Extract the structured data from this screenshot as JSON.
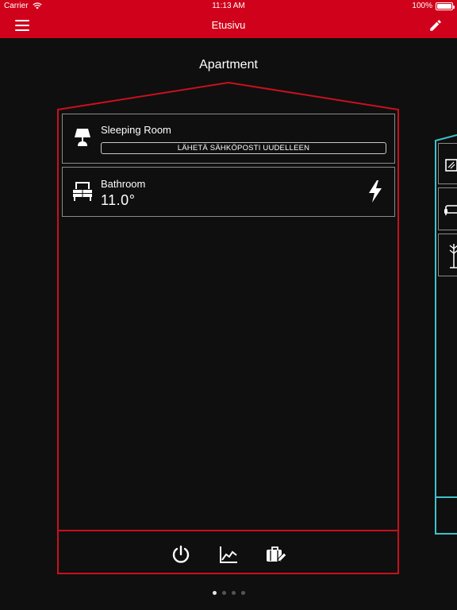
{
  "status_bar": {
    "carrier": "Carrier",
    "time": "11:13 AM",
    "battery": "100%",
    "battery_level": 1.0
  },
  "nav_bar": {
    "title": "Etusivu"
  },
  "page": {
    "title": "Apartment"
  },
  "rooms": [
    {
      "name": "Sleeping Room",
      "icon": "lamp-icon",
      "action_label": "LÄHETÄ SÄHKÖPOSTI UUDELLEEN"
    },
    {
      "name": "Bathroom",
      "icon": "dresser-icon",
      "temperature": "11.0°",
      "status_icon": "lightning-icon"
    }
  ],
  "bottom_toolbar": {
    "icons": [
      "power-icon",
      "chart-icon",
      "suitcase-edit-icon"
    ]
  },
  "side_building": {
    "icons": [
      "window-icon",
      "sofa-icon",
      "coat-rack-icon"
    ]
  },
  "pagination": {
    "total": 4,
    "active": 0
  },
  "colors": {
    "accent": "#d0021b",
    "house_outline": "#c8101e",
    "side_outline": "#3fc1c9",
    "background": "#0f0f0f"
  }
}
